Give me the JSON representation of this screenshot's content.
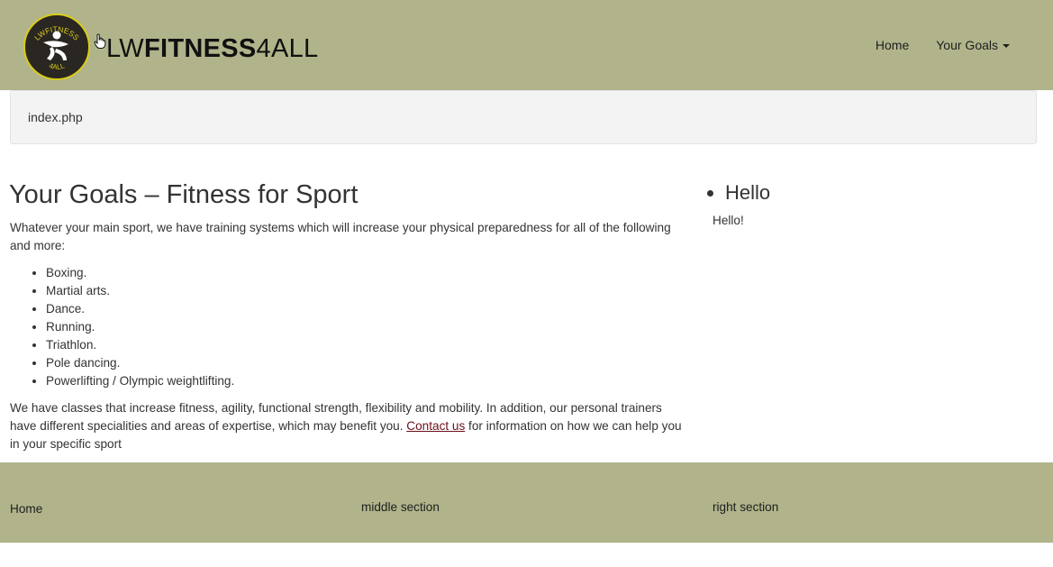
{
  "header": {
    "brand_pre": "LW",
    "brand_mid": "FITNESS",
    "brand_post": "4ALL",
    "logo_text_top": "LWFITNESS",
    "logo_text_bottom": "4ALL",
    "nav": [
      {
        "label": "Home"
      },
      {
        "label": "Your Goals"
      }
    ]
  },
  "breadcrumb": {
    "text": "index.php"
  },
  "main": {
    "title": "Your Goals – Fitness for Sport",
    "intro": "Whatever your main sport, we have training systems which will increase your physical preparedness for all of the following and more:",
    "sports": [
      "Boxing.",
      "Martial arts.",
      "Dance.",
      "Running.",
      "Triathlon.",
      "Pole dancing.",
      "Powerlifting / Olympic weightlifting."
    ],
    "outro_before": "We have classes that increase fitness, agility, functional strength, flexibility and mobility. In addition, our personal trainers have different specialities and areas of expertise, which may benefit you.  ",
    "contact_link": "Contact us",
    "outro_after": " for information on how we can help you in your specific sport"
  },
  "sidebar": {
    "heading": "Hello",
    "text": "Hello!"
  },
  "footer": {
    "home": "Home",
    "middle": "middle section",
    "right": "right section"
  },
  "colors": {
    "header_bg": "#b1b48a",
    "footer_bg": "#b1b48a",
    "logo_ring": "#d8cc1a",
    "link": "#6b0f1a"
  }
}
